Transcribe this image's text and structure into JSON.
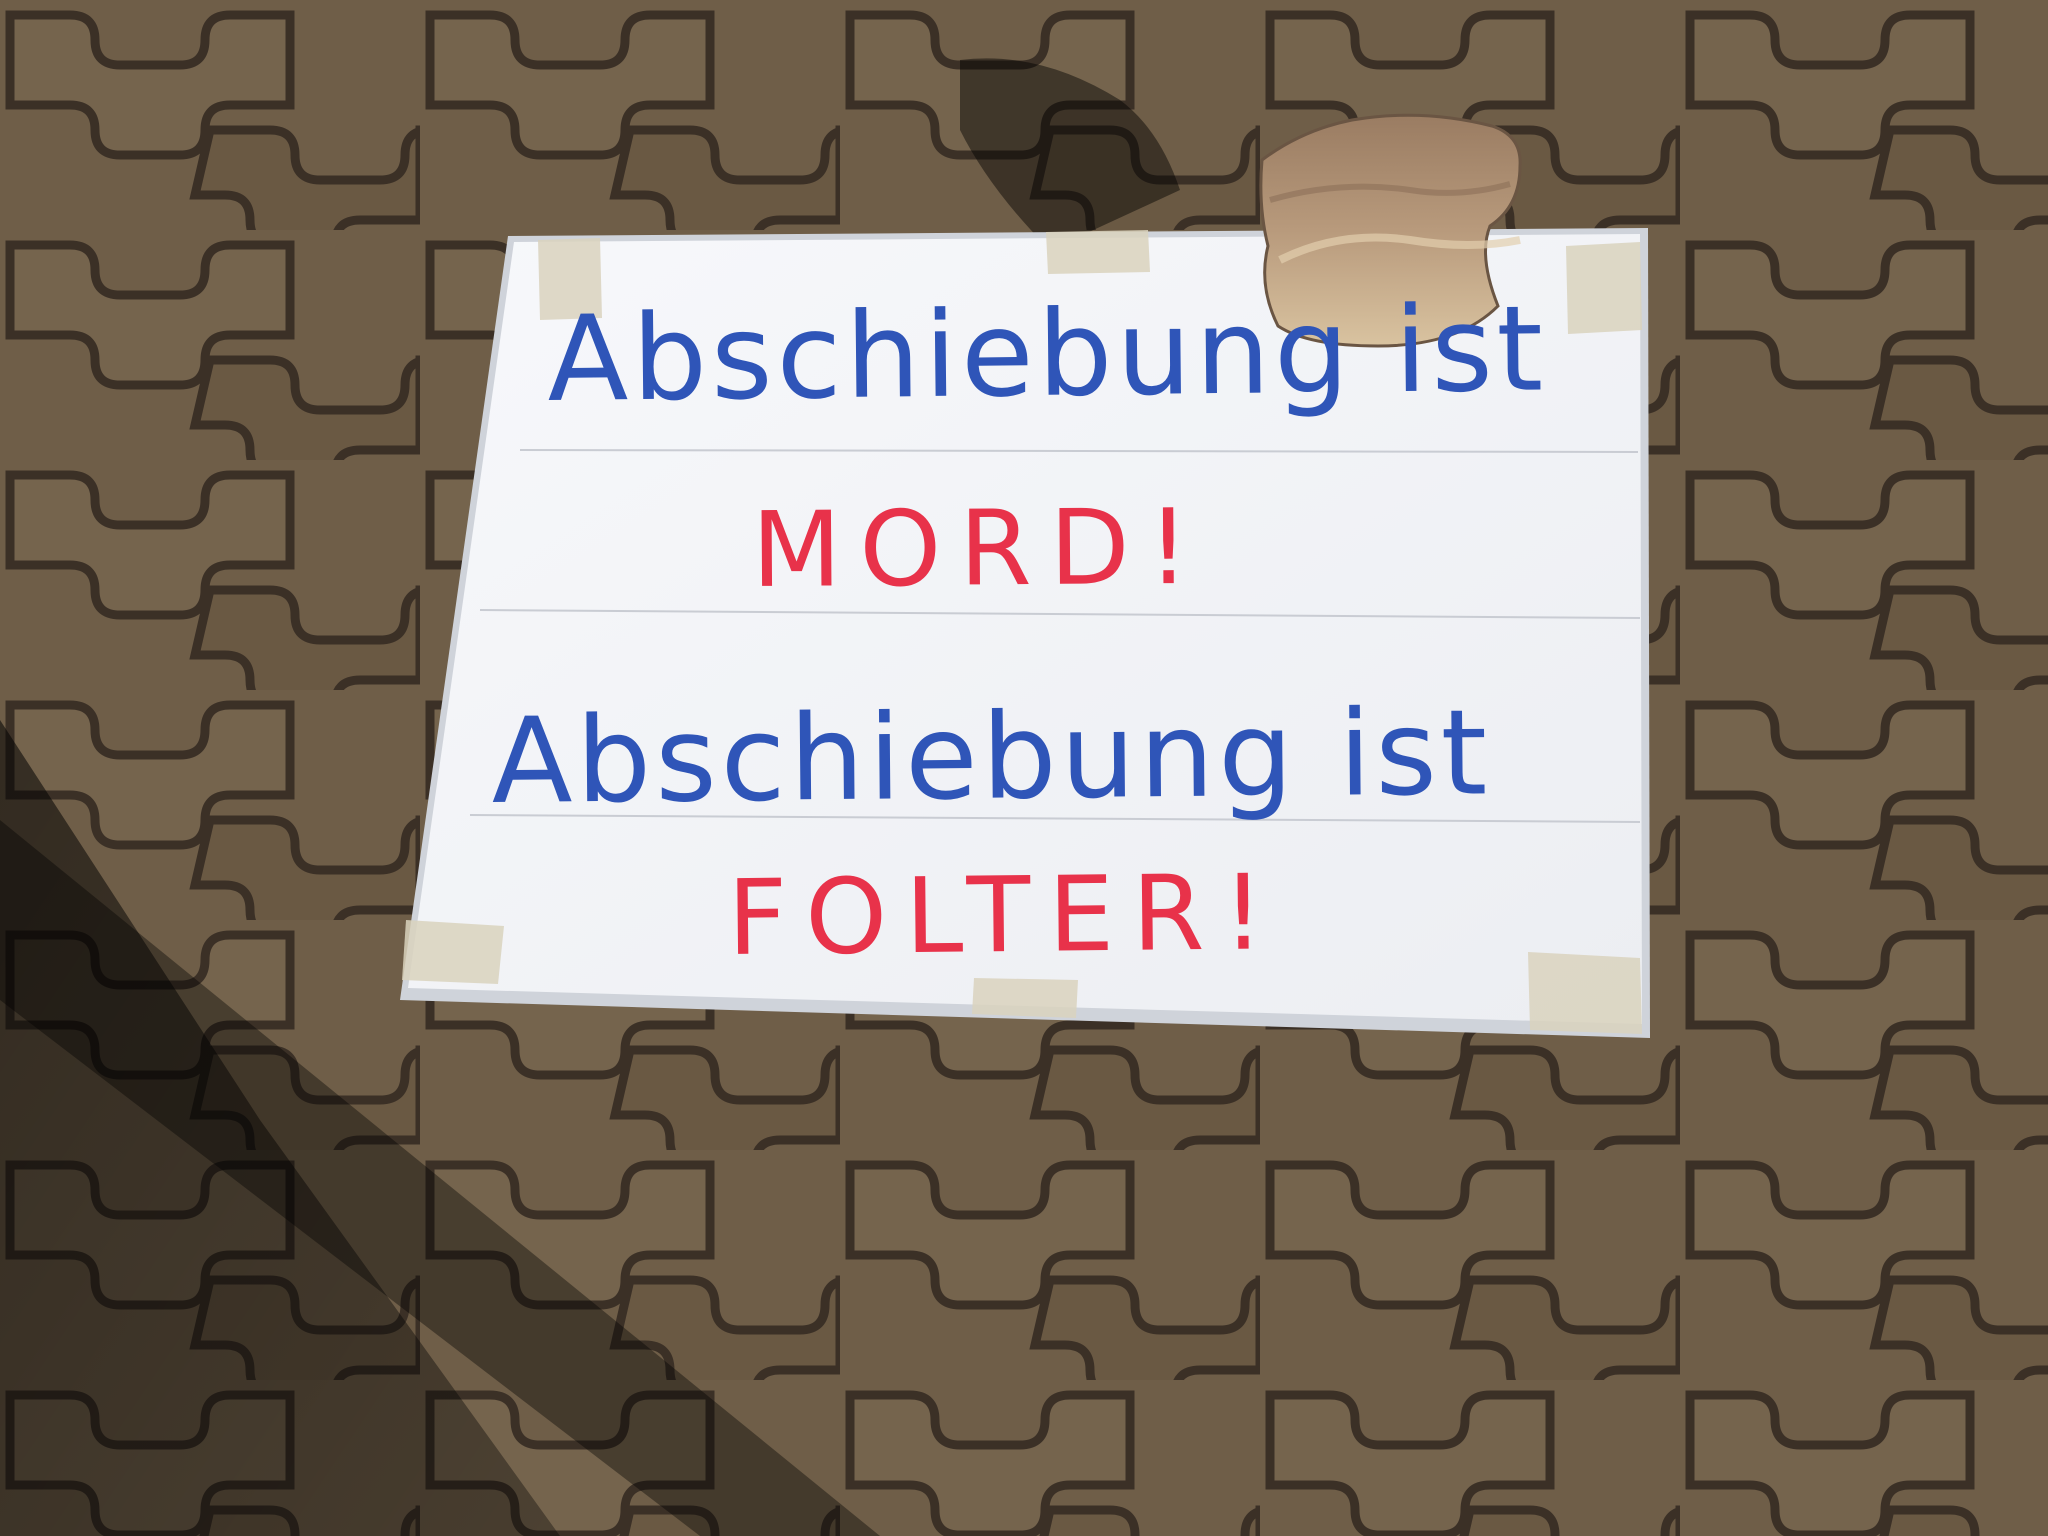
{
  "sign": {
    "line1": "Abschiebung ist",
    "line2": "MORD!",
    "line3": "Abschiebung ist",
    "line4": "FOLTER!"
  },
  "colors": {
    "pavement": "#6b5a45",
    "paving_joint": "#3b3026",
    "paper": "#f4f5f8",
    "blue_marker": "#2f55b8",
    "red_marker": "#e8324a",
    "tape": "#d9d2bd",
    "stone": "#a88d72"
  }
}
